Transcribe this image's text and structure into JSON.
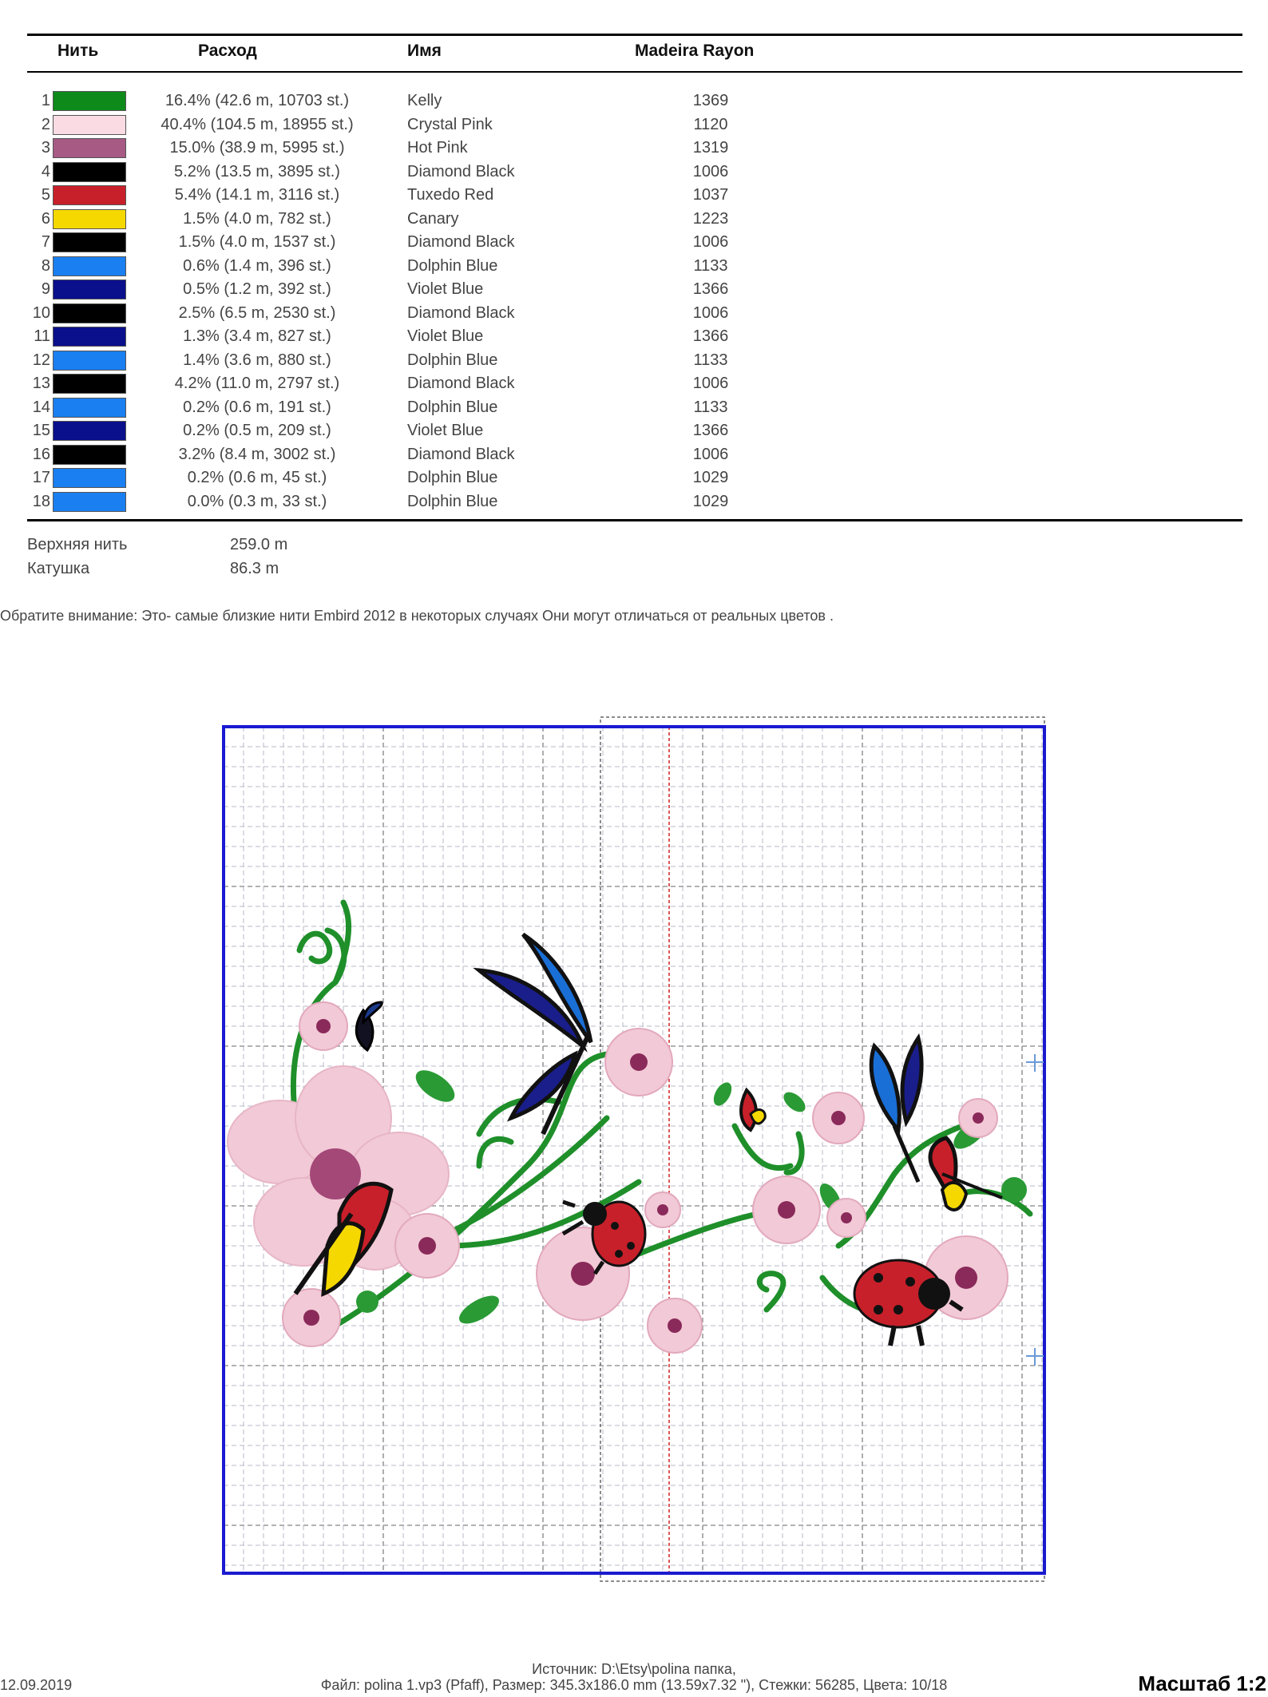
{
  "headers": {
    "thread": "Нить",
    "usage": "Расход",
    "name": "Имя",
    "brand": "Madeira Rayon"
  },
  "threads": [
    {
      "n": "1",
      "color": "#0e8a1a",
      "usage": "16.4% (42.6 m, 10703 st.)",
      "name": "Kelly",
      "code": "1369"
    },
    {
      "n": "2",
      "color": "#fadbe3",
      "usage": "40.4% (104.5 m, 18955 st.)",
      "name": "Crystal Pink",
      "code": "1120"
    },
    {
      "n": "3",
      "color": "#a65a84",
      "usage": "15.0% (38.9 m, 5995 st.)",
      "name": "Hot Pink",
      "code": "1319"
    },
    {
      "n": "4",
      "color": "#000000",
      "usage": "5.2% (13.5 m, 3895 st.)",
      "name": "Diamond Black",
      "code": "1006"
    },
    {
      "n": "5",
      "color": "#c8202a",
      "usage": "5.4% (14.1 m, 3116 st.)",
      "name": "Tuxedo Red",
      "code": "1037"
    },
    {
      "n": "6",
      "color": "#f5d800",
      "usage": "1.5% (4.0 m, 782 st.)",
      "name": "Canary",
      "code": "1223"
    },
    {
      "n": "7",
      "color": "#000000",
      "usage": "1.5% (4.0 m, 1537 st.)",
      "name": "Diamond Black",
      "code": "1006"
    },
    {
      "n": "8",
      "color": "#1a7ff0",
      "usage": "0.6% (1.4 m, 396 st.)",
      "name": "Dolphin Blue",
      "code": "1133"
    },
    {
      "n": "9",
      "color": "#0a0f8c",
      "usage": "0.5% (1.2 m, 392 st.)",
      "name": "Violet Blue",
      "code": "1366"
    },
    {
      "n": "10",
      "color": "#000000",
      "usage": "2.5% (6.5 m, 2530 st.)",
      "name": "Diamond Black",
      "code": "1006"
    },
    {
      "n": "11",
      "color": "#0a0f8c",
      "usage": "1.3% (3.4 m, 827 st.)",
      "name": "Violet Blue",
      "code": "1366"
    },
    {
      "n": "12",
      "color": "#1a7ff0",
      "usage": "1.4% (3.6 m, 880 st.)",
      "name": "Dolphin Blue",
      "code": "1133"
    },
    {
      "n": "13",
      "color": "#000000",
      "usage": "4.2% (11.0 m, 2797 st.)",
      "name": "Diamond Black",
      "code": "1006"
    },
    {
      "n": "14",
      "color": "#1a7ff0",
      "usage": "0.2% (0.6 m, 191 st.)",
      "name": "Dolphin Blue",
      "code": "1133"
    },
    {
      "n": "15",
      "color": "#0a0f8c",
      "usage": "0.2% (0.5 m, 209 st.)",
      "name": "Violet Blue",
      "code": "1366"
    },
    {
      "n": "16",
      "color": "#000000",
      "usage": "3.2% (8.4 m, 3002 st.)",
      "name": "Diamond Black",
      "code": "1006"
    },
    {
      "n": "17",
      "color": "#1a7ff0",
      "usage": "0.2% (0.6 m, 45 st.)",
      "name": "Dolphin Blue",
      "code": "1029"
    },
    {
      "n": "18",
      "color": "#1a7ff0",
      "usage": "0.0% (0.3 m, 33 st.)",
      "name": "Dolphin Blue",
      "code": "1029"
    }
  ],
  "totals": {
    "top_label": "Верхняя нить",
    "top_value": "259.0 m",
    "bobbin_label": "Катушка",
    "bobbin_value": "86.3 m"
  },
  "note": "Обратите внимание: Это- самые близкие нити Embird 2012 в некоторых случаях Они могут отличаться от реальных цветов .",
  "footer": {
    "date": "12.09.2019",
    "source": "Источник: D:\\Etsy\\polina папка,",
    "file_info": "Файл: polina 1.vp3 (Pfaff), Размер: 345.3x186.0 mm (13.59x7.32 \"), Стежки: 56285, Цвета: 10/18",
    "scale": "Масштаб 1:2"
  },
  "colors": {
    "frame": "#1a1ad0",
    "grid": "#b8b8c8",
    "leaf": "#1f8f2a",
    "petal": "#f2c9d6",
    "petal_center": "#8a2a5a"
  }
}
